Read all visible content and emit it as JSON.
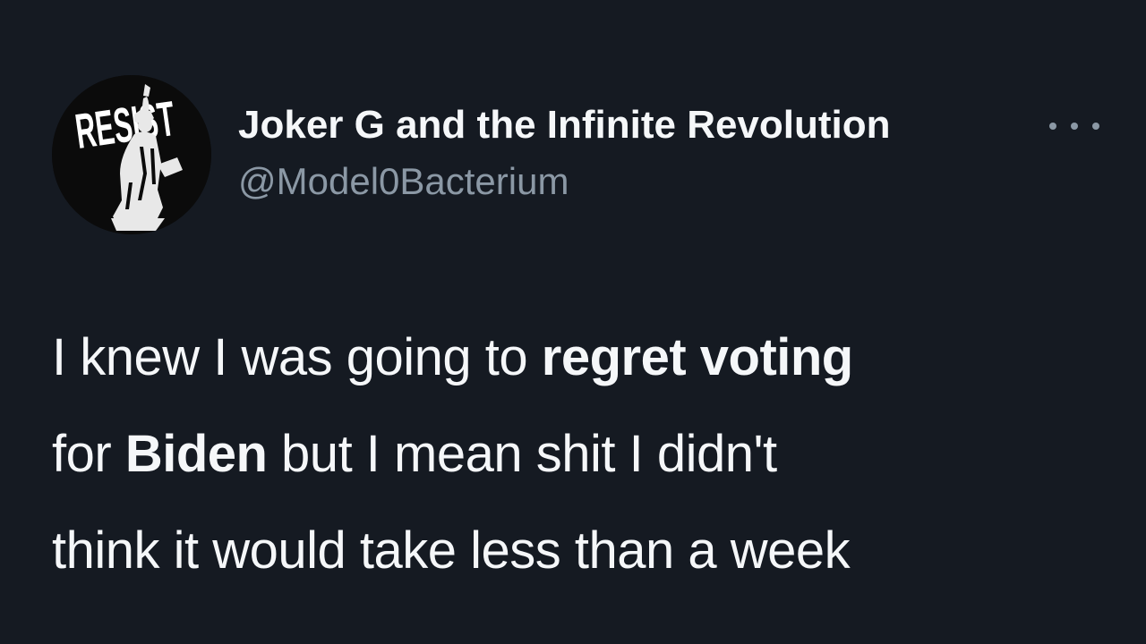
{
  "tweet": {
    "author": {
      "display_name": "Joker G and the Infinite Revolution",
      "handle": "@Model0Bacterium",
      "avatar_text": "RESIST"
    },
    "more_icon": "more-horizontal-icon",
    "text_lines": [
      {
        "a": "I knew I was going to ",
        "b": "regret voting",
        "c": ""
      },
      {
        "a": "for ",
        "b": "Biden",
        "c": " but I mean shit I didn't"
      },
      {
        "a": "think it would take less than a week",
        "b": "",
        "c": ""
      }
    ]
  },
  "colors": {
    "background": "#151a22",
    "text_primary": "#f5f7f9",
    "text_secondary": "#8b98a5"
  }
}
